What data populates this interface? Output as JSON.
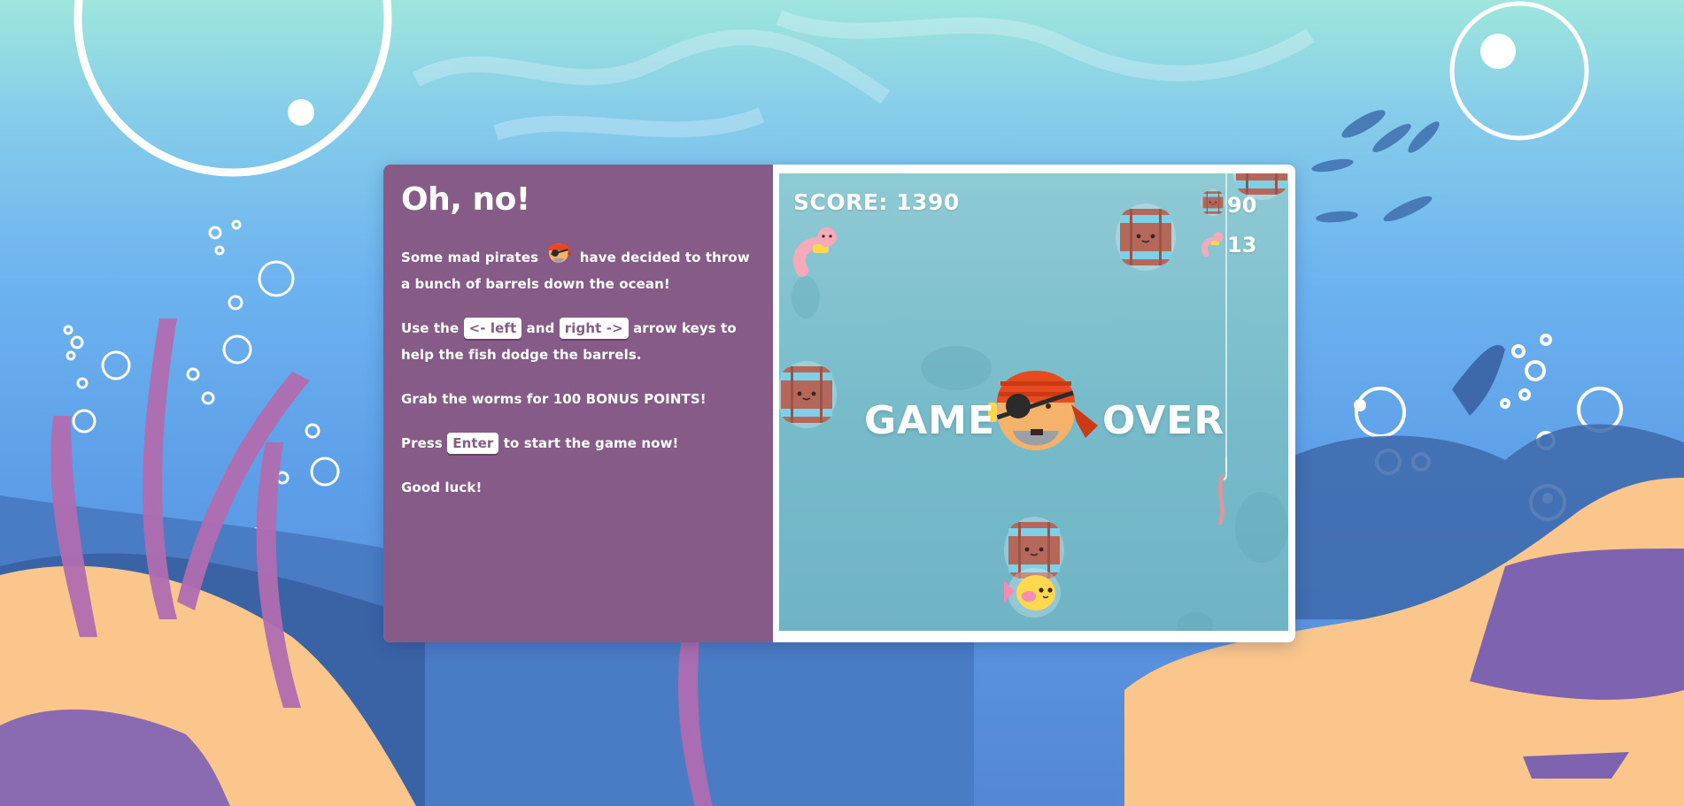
{
  "instructions": {
    "title": "Oh, no!",
    "p1_before": "Some mad pirates",
    "p1_after": "have decided to throw a bunch of barrels down the ocean!",
    "p2_before": "Use the",
    "key_left": "<- left",
    "p2_and": "and",
    "key_right": "right ->",
    "p2_after": "arrow keys to help the fish dodge the barrels.",
    "p3": "Grab the worms for 100 BONUS POINTS!",
    "p4_before": "Press",
    "key_enter": "Enter",
    "p4_after": "to start the game now!",
    "p5": "Good luck!"
  },
  "game": {
    "score_label": "SCORE: 1390",
    "barrels_count": "90",
    "worms_count": "13",
    "game_over_left": "GAME",
    "game_over_right": "OVER",
    "icons": [
      "pirate-icon",
      "barrel-icon",
      "worm-icon",
      "fish-icon",
      "hook-icon"
    ]
  },
  "colors": {
    "panel_purple": "#875b87",
    "game_water": "#7fc1cf",
    "barrel_wood": "#b5685a",
    "barrel_band": "#7dd0e6",
    "fish_yellow": "#ffd84d",
    "pirate_bandana": "#e84a1f"
  }
}
